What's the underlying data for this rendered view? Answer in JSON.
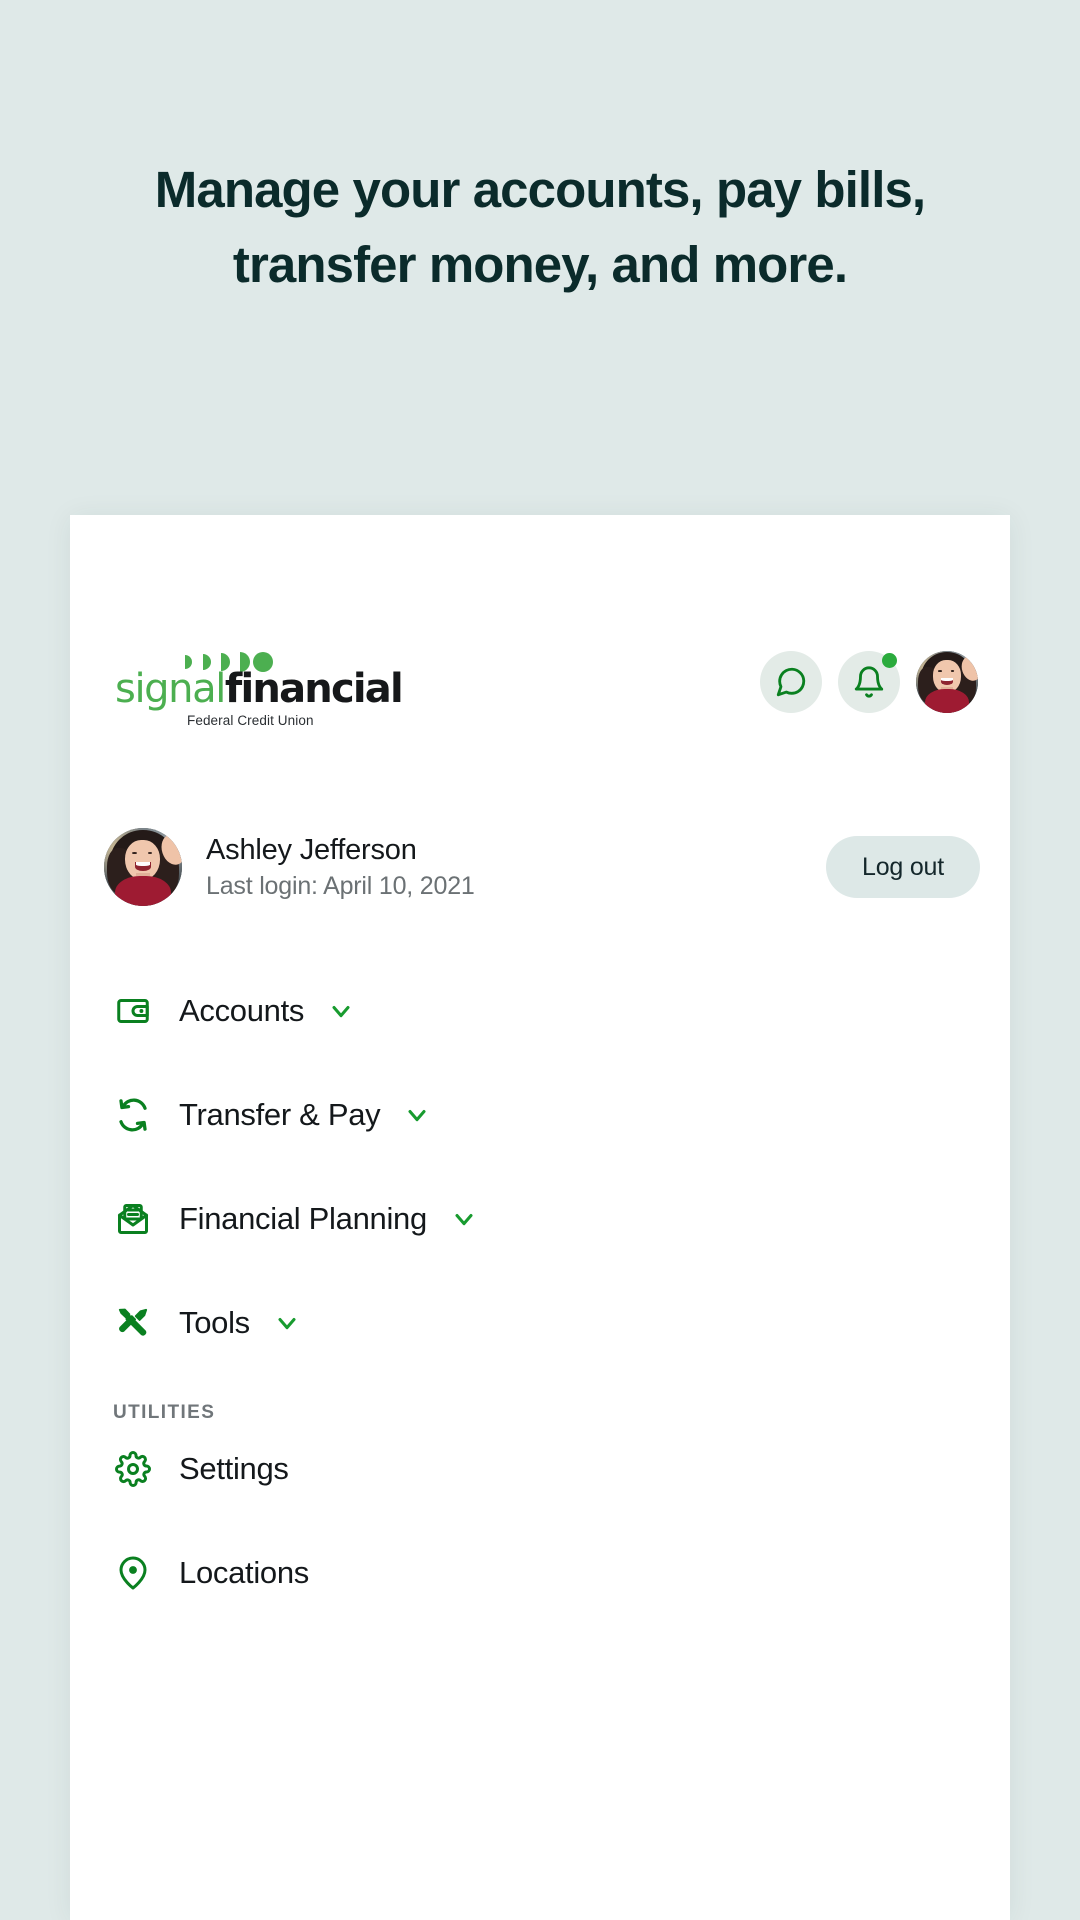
{
  "page": {
    "background_color": "#dfe9e8",
    "headline_color": "#0b2b2b",
    "accent_green": "#0a8020",
    "brand_green": "#4caf50"
  },
  "headline": {
    "line1": "Manage your accounts, pay bills,",
    "line2": "transfer money, and more."
  },
  "card": {
    "logo": {
      "signal": "signal",
      "financial": "financial",
      "tagline": "Federal Credit Union"
    },
    "header_actions": [
      {
        "name": "messages-icon",
        "icon": "chat-bubble-icon",
        "badge": false
      },
      {
        "name": "notifications-icon",
        "icon": "bell-icon",
        "badge": true
      },
      {
        "name": "profile-avatar",
        "icon": "avatar",
        "badge": false
      }
    ],
    "user": {
      "name": "Ashley Jefferson",
      "last_login": "Last login: April 10, 2021",
      "logout_label": "Log out"
    },
    "nav": [
      {
        "label": "Accounts",
        "icon": "wallet-icon",
        "chevron": true
      },
      {
        "label": "Transfer & Pay",
        "icon": "sync-arrows-icon",
        "chevron": true
      },
      {
        "label": "Financial Planning",
        "icon": "envelope-document-icon",
        "chevron": true
      },
      {
        "label": "Tools",
        "icon": "hammer-screwdriver-icon",
        "chevron": true
      }
    ],
    "utilities": {
      "section_label": "UTILITIES",
      "items": [
        {
          "label": "Settings",
          "icon": "gear-icon",
          "chevron": false
        },
        {
          "label": "Locations",
          "icon": "map-pin-icon",
          "chevron": false
        }
      ]
    }
  }
}
